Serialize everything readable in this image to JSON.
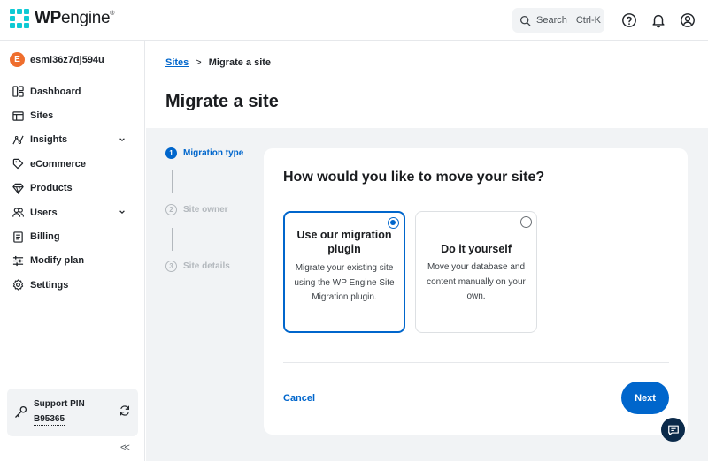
{
  "brand": {
    "name_bold": "WP",
    "name_light": "engine",
    "mark": "®"
  },
  "search": {
    "label": "Search",
    "shortcut": "Ctrl-K"
  },
  "account": {
    "initial": "E",
    "name": "esml36z7dj594u"
  },
  "nav": {
    "items": [
      {
        "label": "Dashboard",
        "icon": "dashboard-icon"
      },
      {
        "label": "Sites",
        "icon": "sites-icon"
      },
      {
        "label": "Insights",
        "icon": "insights-icon",
        "expandable": true
      },
      {
        "label": "eCommerce",
        "icon": "tag-icon"
      },
      {
        "label": "Products",
        "icon": "diamond-icon"
      },
      {
        "label": "Users",
        "icon": "users-icon",
        "expandable": true
      },
      {
        "label": "Billing",
        "icon": "billing-icon"
      },
      {
        "label": "Modify plan",
        "icon": "sliders-icon"
      },
      {
        "label": "Settings",
        "icon": "gear-icon"
      }
    ]
  },
  "support": {
    "label": "Support PIN",
    "pin": "B95365"
  },
  "collapse": {
    "label": "<<"
  },
  "breadcrumb": {
    "parent": "Sites",
    "separator": ">",
    "current": "Migrate a site"
  },
  "page": {
    "title": "Migrate a site"
  },
  "steps": [
    {
      "num": "1",
      "label": "Migration type",
      "state": "active"
    },
    {
      "num": "2",
      "label": "Site owner",
      "state": "idle"
    },
    {
      "num": "3",
      "label": "Site details",
      "state": "idle"
    }
  ],
  "form": {
    "question": "How would you like to move your site?",
    "options": [
      {
        "title": "Use our migration plugin",
        "description": "Migrate your existing site using the WP Engine Site Migration plugin.",
        "selected": true
      },
      {
        "title": "Do it yourself",
        "description": "Move your database and content manually on your own.",
        "selected": false
      }
    ],
    "cancel_label": "Cancel",
    "next_label": "Next"
  },
  "colors": {
    "accent": "#0066cc",
    "logo": "#0ecad4",
    "avatar": "#ef6e2d",
    "chat": "#0b2a4a"
  }
}
